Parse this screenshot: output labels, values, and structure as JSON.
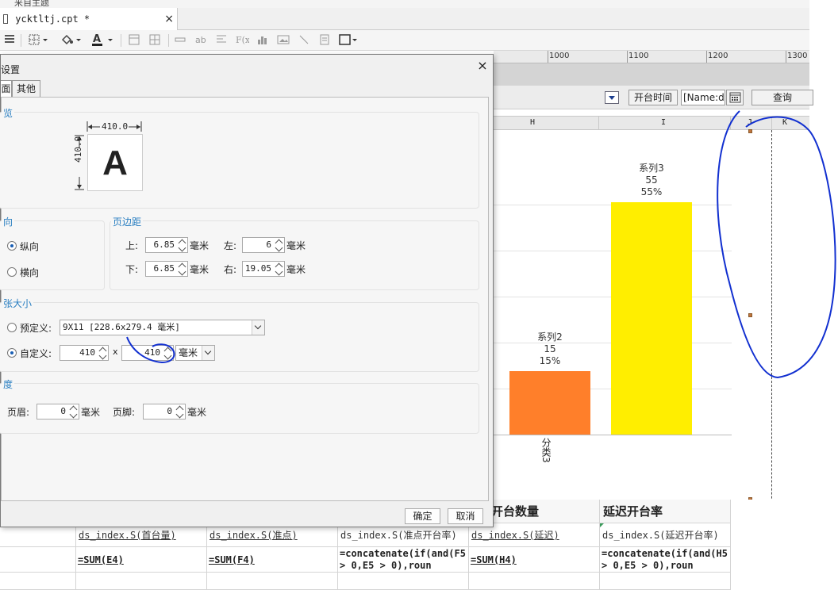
{
  "top_strip": {
    "text": "来自主题"
  },
  "tab": {
    "filename": "ycktltj.cpt *",
    "close": "×"
  },
  "ruler": {
    "labels": [
      "1000",
      "1100",
      "1200",
      "1300"
    ]
  },
  "param_bar": {
    "start_time_label": "开台时间",
    "name_field_value": "[Name:ds",
    "query_label": "查询"
  },
  "column_headers": [
    "H",
    "I",
    "J",
    "K"
  ],
  "chart_data": {
    "type": "bar",
    "categories": [
      "分类3"
    ],
    "x_tick_label": "分类3",
    "series": [
      {
        "name": "系列2",
        "values": [
          15
        ],
        "percent_label": "15%",
        "color": "#ff7f2a"
      },
      {
        "name": "系列3",
        "values": [
          55
        ],
        "percent_label": "55%",
        "color": "#ffee00"
      }
    ],
    "value_labels": [
      "15",
      "55"
    ],
    "ylim": [
      0,
      60
    ],
    "grid": true
  },
  "sheet": {
    "headers": [
      "开台数量",
      "延迟开台率"
    ],
    "ds_row": [
      "ds_index.S(首台量)",
      "ds_index.S(准点)",
      "ds_index.S(准点开台率)",
      "ds_index.S(延迟)",
      "ds_index.S(延迟开台率)"
    ],
    "formula_row": [
      "=SUM(E4)",
      "=SUM(F4)",
      "=concatenate(if(and(F5 > 0,E5 > 0),roun",
      "=SUM(H4)",
      "=concatenate(if(and(H5 > 0,E5 > 0),roun"
    ]
  },
  "dialog": {
    "title": "设置",
    "close": "×",
    "tabs": [
      "面",
      "其他"
    ],
    "preview": {
      "group_title": "览",
      "width_label": "410.0",
      "height_label": "410.0",
      "letter": "A"
    },
    "orientation": {
      "group_title": "向",
      "portrait": "纵向",
      "landscape": "横向"
    },
    "margins": {
      "group_title": "页边距",
      "top_label": "上:",
      "top_value": "6.85",
      "left_label": "左:",
      "left_value": "6",
      "bottom_label": "下:",
      "bottom_value": "6.85",
      "right_label": "右:",
      "right_value": "19.05",
      "unit": "毫米"
    },
    "paper_size": {
      "group_title": "张大小",
      "predefined_label": "预定义:",
      "predefined_value": "9X11 [228.6x279.4 毫米]",
      "custom_label": "自定义:",
      "custom_width": "410",
      "times": "x",
      "custom_height": "410",
      "unit": "毫米"
    },
    "header_footer": {
      "group_title": "度",
      "header_label": "页眉:",
      "header_value": "0",
      "footer_label": "页脚:",
      "footer_value": "0",
      "unit": "毫米"
    },
    "ok": "确定",
    "cancel": "取消"
  }
}
